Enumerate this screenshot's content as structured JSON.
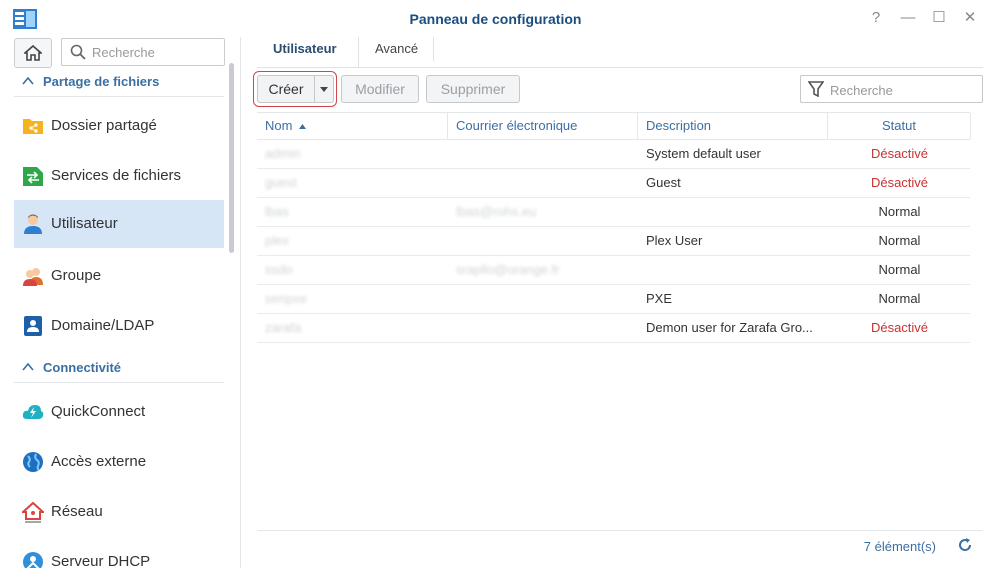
{
  "window": {
    "title": "Panneau de configuration",
    "controls": [
      "?",
      "—",
      "☐",
      "✕"
    ]
  },
  "sidebar": {
    "search_placeholder": "Recherche",
    "sections": [
      {
        "label": "Partage de fichiers"
      },
      {
        "label": "Connectivité"
      }
    ],
    "items": [
      {
        "label": "Dossier partagé",
        "icon": "shared-folder-icon"
      },
      {
        "label": "Services de fichiers",
        "icon": "file-services-icon"
      },
      {
        "label": "Utilisateur",
        "icon": "user-icon",
        "active": true
      },
      {
        "label": "Groupe",
        "icon": "group-icon"
      },
      {
        "label": "Domaine/LDAP",
        "icon": "domain-ldap-icon"
      },
      {
        "label": "QuickConnect",
        "icon": "quickconnect-icon"
      },
      {
        "label": "Accès externe",
        "icon": "external-access-icon"
      },
      {
        "label": "Réseau",
        "icon": "network-icon"
      },
      {
        "label": "Serveur DHCP",
        "icon": "dhcp-server-icon"
      }
    ]
  },
  "tabs": [
    {
      "label": "Utilisateur",
      "active": true
    },
    {
      "label": "Avancé"
    }
  ],
  "toolbar": {
    "create": "Créer",
    "modify": "Modifier",
    "delete": "Supprimer",
    "search_placeholder": "Recherche"
  },
  "table": {
    "columns": [
      "Nom",
      "Courrier électronique",
      "Description",
      "Statut"
    ],
    "rows": [
      {
        "name": "admin",
        "email": "",
        "description": "System default user",
        "status": "Désactivé"
      },
      {
        "name": "guest",
        "email": "",
        "description": "Guest",
        "status": "Désactivé"
      },
      {
        "name": "lbas",
        "email": "lbas@rohs.eu",
        "description": "",
        "status": "Normal"
      },
      {
        "name": "plex",
        "email": "",
        "description": "Plex User",
        "status": "Normal"
      },
      {
        "name": "ssdo",
        "email": "srapllo@orange.fr",
        "description": "",
        "status": "Normal"
      },
      {
        "name": "senpxe",
        "email": "",
        "description": "PXE",
        "status": "Normal"
      },
      {
        "name": "zarafa",
        "email": "",
        "description": "Demon user for Zarafa Gro...",
        "status": "Désactivé"
      }
    ]
  },
  "footer": {
    "count": "7 élément(s)"
  },
  "colors": {
    "accent": "#3b6fa3",
    "disabled_status": "#c8332f",
    "active_bg": "#d6e6f6"
  }
}
